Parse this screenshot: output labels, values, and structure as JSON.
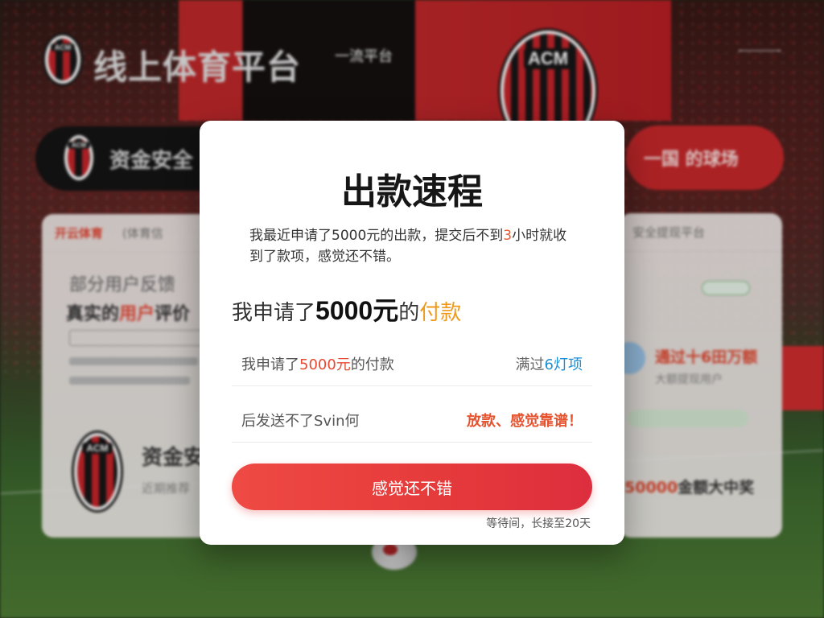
{
  "background": {
    "site_title": "线上体育平台",
    "site_subtitle": "一流平台",
    "logo_text": "ACM",
    "pill_left_label": "资金安全",
    "pill_right_label": "一国 的球场",
    "card_left": {
      "brand": "开云体育",
      "head_text": "(体育信",
      "title": "部分用户反馈",
      "title2_prefix": "真实的",
      "title2_highlight": "用户",
      "title2_suffix": "评价",
      "name": "资金安",
      "sub": "近期推荐"
    },
    "card_right": {
      "head_text": "安全提现平台",
      "title": "通过十6田万额",
      "sub": "大额提现用户",
      "amount_prefix": "50000",
      "amount_suffix": "金额大中奖"
    }
  },
  "modal": {
    "title": "出款速程",
    "intro_pre": "我最近申请了5000元的出款，提交后不到",
    "intro_hl": "3",
    "intro_post": "小时就收到了款项，感觉还不错。",
    "headline_pre": "我申请了",
    "headline_amount": "5000元",
    "headline_mid": "的",
    "headline_orange": "付款",
    "row1": {
      "left_pre": "我申请了",
      "left_amount": "5000元",
      "left_post": "的付款",
      "right_pre": "满过",
      "right_blue": "6灯项"
    },
    "row2": {
      "left": "后发送不了Svin何",
      "right": "放款、感觉靠谱！"
    },
    "cta_label": "感觉还不错",
    "footnote": "等待间，长接至20天"
  }
}
